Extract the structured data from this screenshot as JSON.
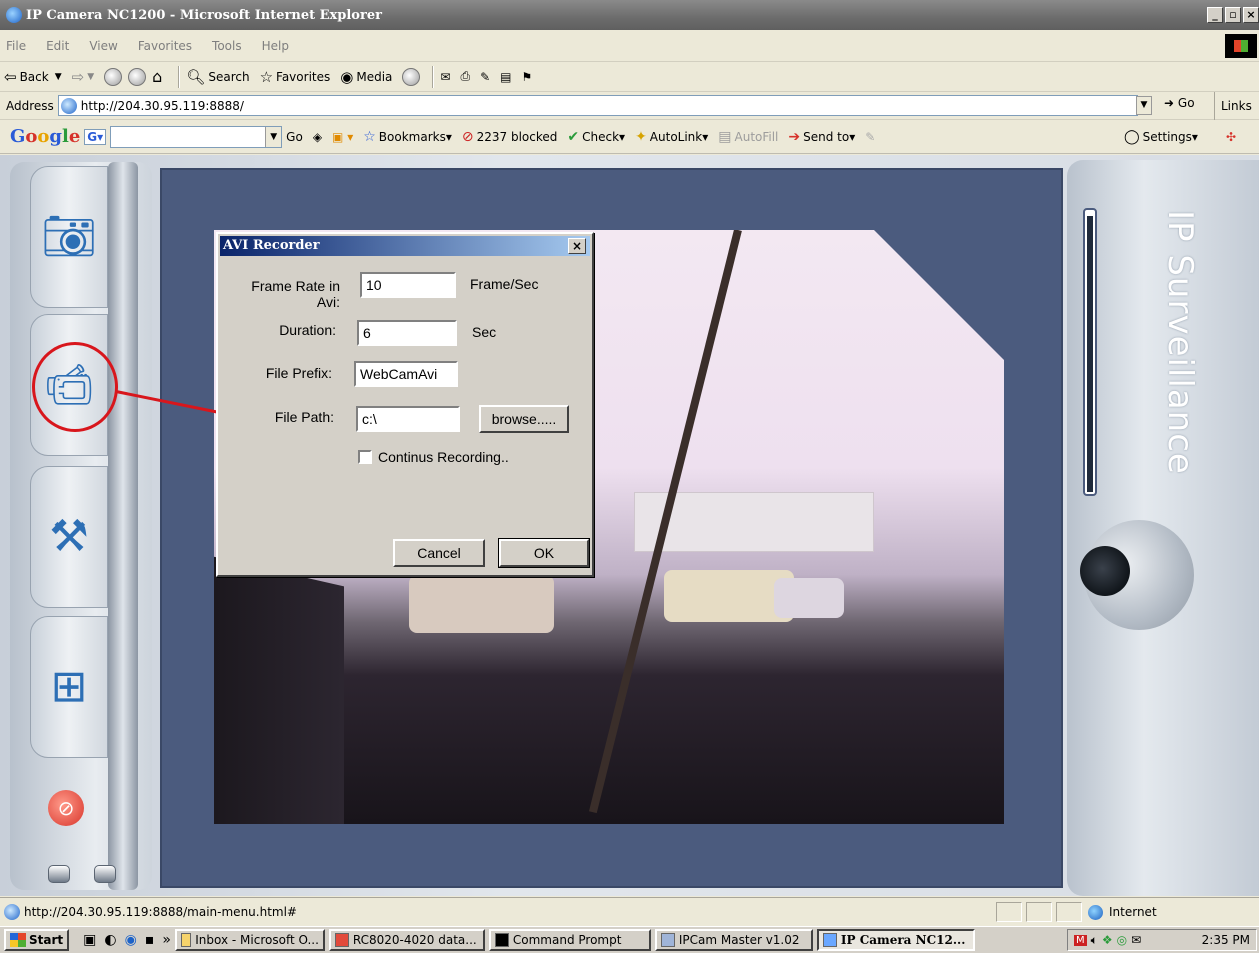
{
  "window": {
    "title": "IP Camera NC1200 - Microsoft Internet Explorer",
    "controls": [
      "_",
      "▫",
      "×"
    ]
  },
  "menu": [
    "File",
    "Edit",
    "View",
    "Favorites",
    "Tools",
    "Help"
  ],
  "toolbar": {
    "back": "Back",
    "search": "Search",
    "favorites": "Favorites",
    "media": "Media"
  },
  "address": {
    "label": "Address",
    "url": "http://204.30.95.119:8888/",
    "go": "Go",
    "links": "Links"
  },
  "google_toolbar": {
    "logo": "Google",
    "go": "Go",
    "bookmarks": "Bookmarks",
    "blocked": "2237 blocked",
    "check": "Check",
    "autolink": "AutoLink",
    "autofill": "AutoFill",
    "send_to": "Send to",
    "settings": "Settings"
  },
  "sidebar": {
    "items": [
      {
        "icon": "camera-icon"
      },
      {
        "icon": "video-camera-icon"
      },
      {
        "icon": "tools-icon"
      },
      {
        "icon": "grid-icon"
      }
    ]
  },
  "brand": {
    "text": "IP Surveillance"
  },
  "dialog": {
    "title": "AVI Recorder",
    "close": "×",
    "fields": {
      "frame_rate": {
        "label": "Frame Rate in Avi:",
        "value": "10",
        "unit": "Frame/Sec"
      },
      "duration": {
        "label": "Duration:",
        "value": "6",
        "unit": "Sec"
      },
      "file_prefix": {
        "label": "File Prefix:",
        "value": "WebCamAvi"
      },
      "file_path": {
        "label": "File Path:",
        "value": "c:\\"
      }
    },
    "browse": "browse.....",
    "checkbox_label": "Continus Recording..",
    "checkbox_checked": false,
    "cancel": "Cancel",
    "ok": "OK"
  },
  "status": {
    "url": "http://204.30.95.119:8888/main-menu.html#",
    "zone": "Internet"
  },
  "taskbar": {
    "start": "Start",
    "more": "»",
    "tasks": [
      {
        "label": "Inbox - Microsoft O...",
        "active": false
      },
      {
        "label": "RC8020-4020 data...",
        "active": false
      },
      {
        "label": "Command Prompt",
        "active": false
      },
      {
        "label": "IPCam Master v1.02",
        "active": false
      },
      {
        "label": "IP Camera NC12...",
        "active": true
      }
    ],
    "clock": "2:35 PM"
  },
  "colors": {
    "annotation": "#d8161c",
    "video_frame": "#4b5b7e",
    "icon_blue": "#2d6fb5"
  }
}
